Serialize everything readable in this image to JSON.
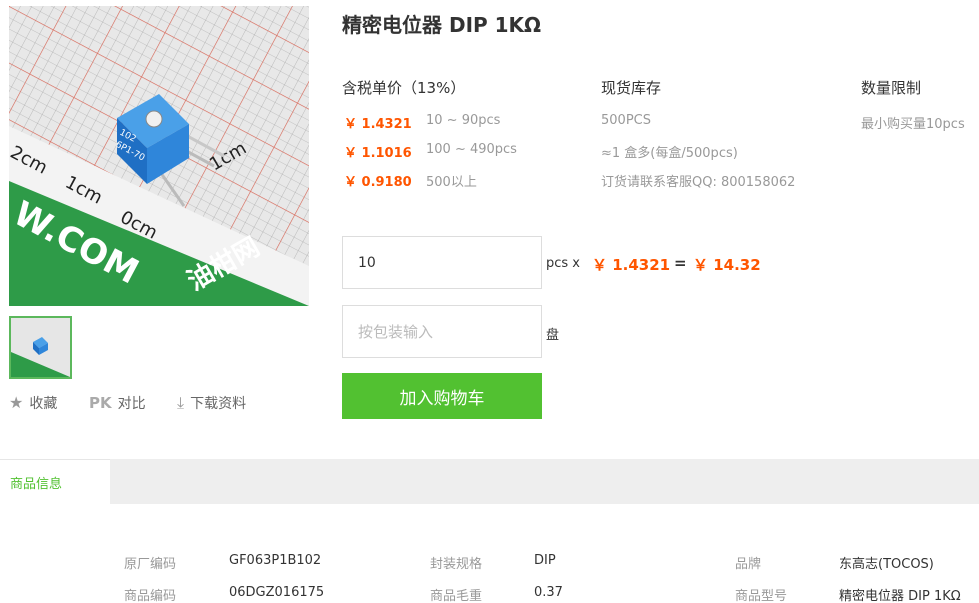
{
  "product": {
    "title": "精密电位器 DIP 1KΩ",
    "image_alt": "精密电位器"
  },
  "gallery": {
    "ruler_labels": [
      "2cm",
      "1cm",
      "0cm",
      "1cm"
    ],
    "component_text": [
      "102",
      "6P1-70"
    ],
    "watermark": "W.COM",
    "logo_text": "油柑网"
  },
  "actions": {
    "favorite_label": "收藏",
    "pk_badge": "PK",
    "compare_label": "对比",
    "download_label": "下载资料"
  },
  "pricing": {
    "headers": {
      "price": "含税单价（13%）",
      "stock": "现货库存",
      "limit": "数量限制"
    },
    "tiers": [
      {
        "price": "￥ 1.4321",
        "range": "10 ~ 90pcs"
      },
      {
        "price": "￥ 1.1016",
        "range": "100 ~ 490pcs"
      },
      {
        "price": "￥ 0.9180",
        "range": "500以上"
      }
    ],
    "stock_lines": [
      "500PCS",
      "≈1 盒多(每盒/500pcs)",
      "订货请联系客服QQ: 800158062"
    ],
    "limit_text": "最小购买量10pcs"
  },
  "order": {
    "quantity_value": "10",
    "quantity_unit": "pcs x",
    "unit_price": "￥ 1.4321",
    "equals": "=",
    "total": "￥ 14.32",
    "pack_placeholder": "按包装输入",
    "pack_unit": "盘",
    "cart_label": "加入购物车"
  },
  "info": {
    "tab_label": "商品信息",
    "specs": [
      {
        "label": "原厂编码",
        "value": "GF063P1B102"
      },
      {
        "label": "封装规格",
        "value": "DIP"
      },
      {
        "label": "品牌",
        "value": "东高志(TOCOS)"
      },
      {
        "label": "商品编码",
        "value": "06DGZ016175"
      },
      {
        "label": "商品毛重",
        "value": "0.37"
      },
      {
        "label": "商品型号",
        "value": "精密电位器 DIP 1KΩ"
      }
    ]
  },
  "colors": {
    "accent_green": "#52c131",
    "price_orange": "#ff5500"
  }
}
